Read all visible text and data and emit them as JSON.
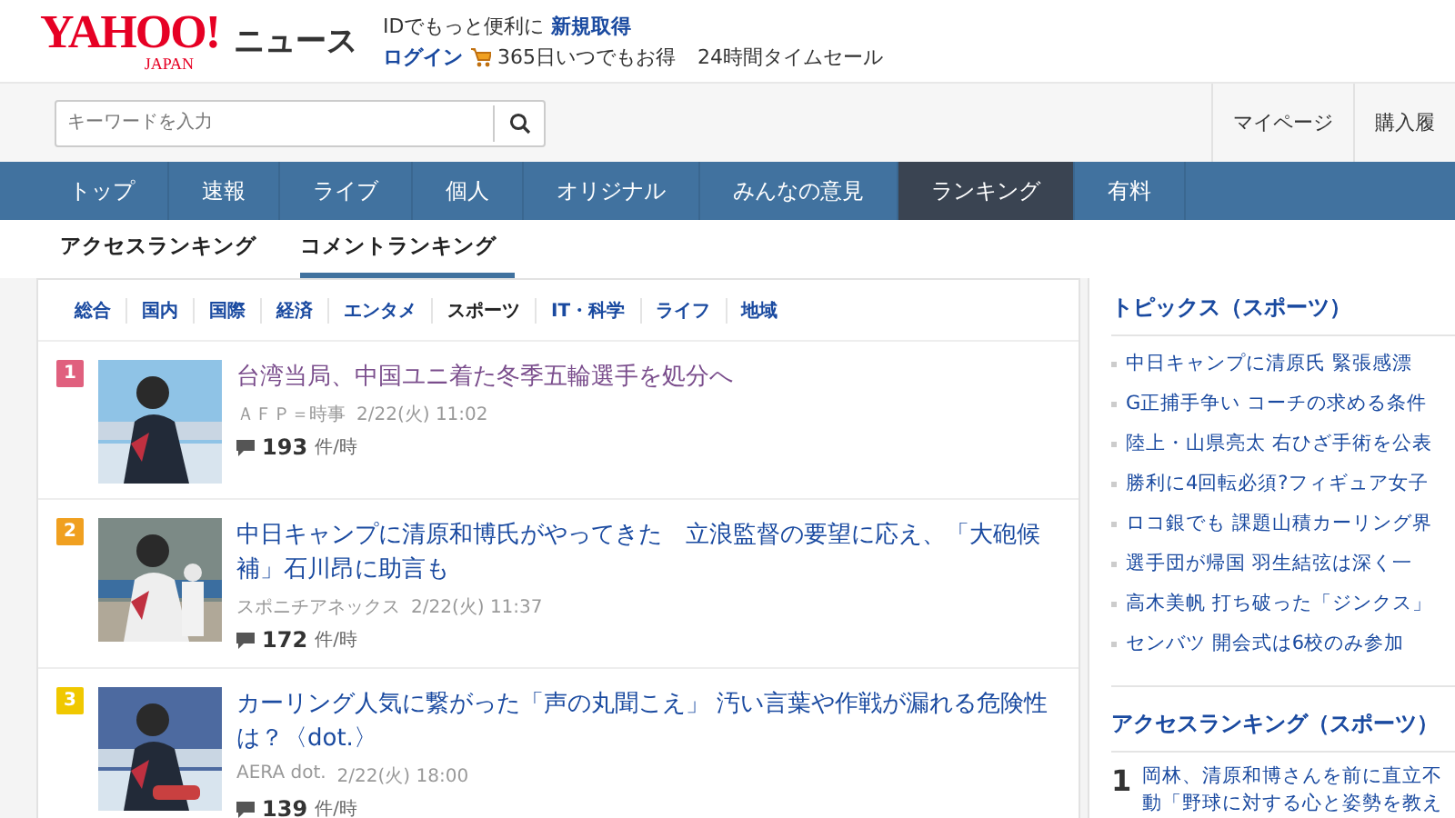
{
  "header": {
    "logo": "YAHOO!",
    "logo_sub": "JAPAN",
    "service": "ニュース",
    "promo_text": "IDでもっと便利に",
    "signup_link": "新規取得",
    "login_link": "ログイン",
    "shopping_link": "365日いつでもお得",
    "sale_link": "24時間タイムセール"
  },
  "search": {
    "placeholder": "キーワードを入力"
  },
  "top_links": [
    "マイページ",
    "購入履"
  ],
  "nav": [
    {
      "label": "トップ",
      "selected": false
    },
    {
      "label": "速報",
      "selected": false
    },
    {
      "label": "ライブ",
      "selected": false
    },
    {
      "label": "個人",
      "selected": false
    },
    {
      "label": "オリジナル",
      "selected": false
    },
    {
      "label": "みんなの意見",
      "selected": false
    },
    {
      "label": "ランキング",
      "selected": true
    },
    {
      "label": "有料",
      "selected": false
    }
  ],
  "sub_tabs": [
    {
      "label": "アクセスランキング",
      "selected": false
    },
    {
      "label": "コメントランキング",
      "selected": true
    }
  ],
  "categories": [
    {
      "label": "総合",
      "selected": false
    },
    {
      "label": "国内",
      "selected": false
    },
    {
      "label": "国際",
      "selected": false
    },
    {
      "label": "経済",
      "selected": false
    },
    {
      "label": "エンタメ",
      "selected": false
    },
    {
      "label": "スポーツ",
      "selected": true
    },
    {
      "label": "IT・科学",
      "selected": false
    },
    {
      "label": "ライフ",
      "selected": false
    },
    {
      "label": "地域",
      "selected": false
    }
  ],
  "articles": [
    {
      "rank": "1",
      "color": "#e0607e",
      "title": "台湾当局、中国ユニ着た冬季五輪選手を処分へ",
      "visited": true,
      "source": "ＡＦＰ＝時事",
      "date": "2/22(火) 11:02",
      "count": "193",
      "unit": "件/時"
    },
    {
      "rank": "2",
      "color": "#f0a020",
      "title": "中日キャンプに清原和博氏がやってきた　立浪監督の要望に応え、「大砲候補」石川昂に助言も",
      "visited": false,
      "source": "スポニチアネックス",
      "date": "2/22(火) 11:37",
      "count": "172",
      "unit": "件/時"
    },
    {
      "rank": "3",
      "color": "#f0c800",
      "title": "カーリング人気に繋がった「声の丸聞こえ」 汚い言葉や作戦が漏れる危険性は？〈dot.〉",
      "visited": false,
      "source": "AERA dot.",
      "date": "2/22(火) 18:00",
      "count": "139",
      "unit": "件/時"
    }
  ],
  "topics": {
    "title": "トピックス（スポーツ）",
    "items": [
      "中日キャンプに清原氏 緊張感漂",
      "G正捕手争い コーチの求める条件",
      "陸上・山県亮太 右ひざ手術を公表",
      "勝利に4回転必須?フィギュア女子",
      "ロコ銀でも 課題山積カーリング界",
      "選手団が帰国 羽生結弦は深く一",
      "高木美帆 打ち破った「ジンクス」",
      "センバツ 開会式は6校のみ参加"
    ]
  },
  "access_ranking": {
    "title": "アクセスランキング（スポーツ）",
    "items": [
      {
        "rank": "1",
        "title": "岡林、清原和博さんを前に直立不動「野球に対する心と姿勢を教え"
      }
    ]
  }
}
